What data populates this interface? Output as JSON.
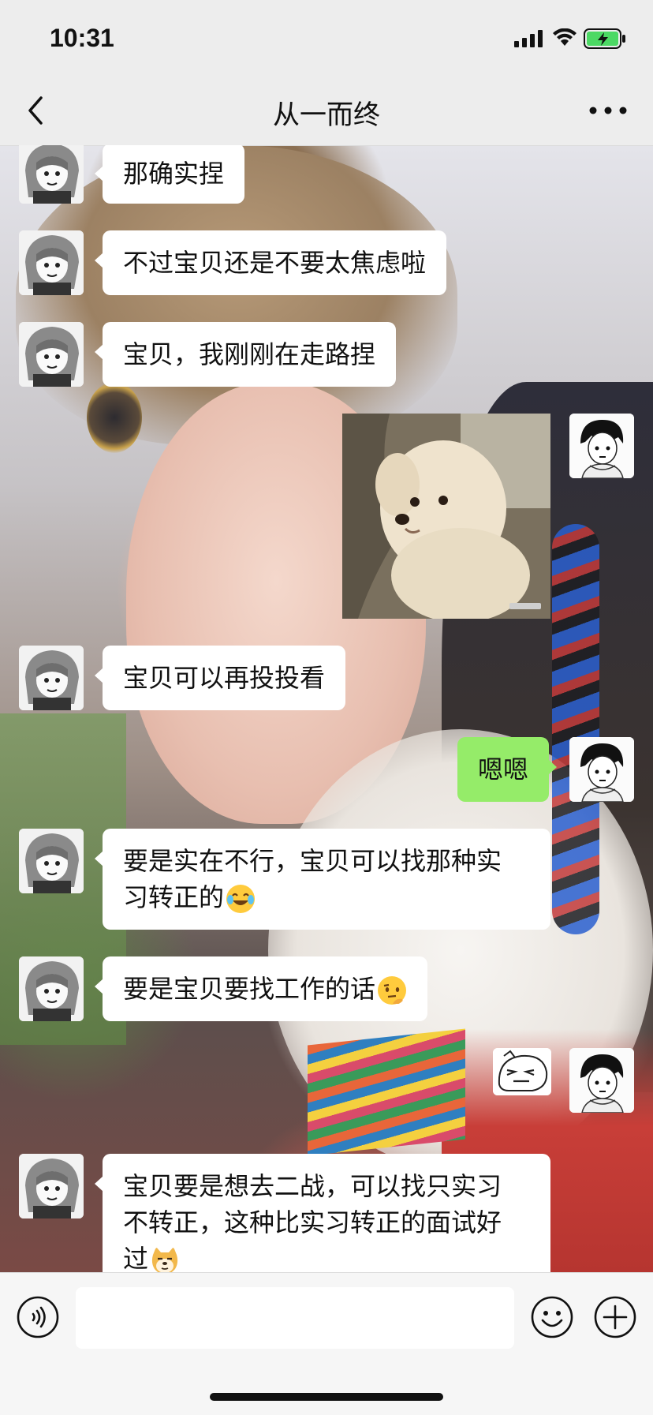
{
  "status_bar": {
    "time": "10:31"
  },
  "nav": {
    "title": "从一而终"
  },
  "messages": [
    {
      "side": "left",
      "text": "那确实捏"
    },
    {
      "side": "left",
      "text": "不过宝贝还是不要太焦虑啦"
    },
    {
      "side": "left",
      "text": "宝贝，我刚刚在走路捏"
    },
    {
      "side": "right",
      "type": "image",
      "icon": "puppy-photo"
    },
    {
      "side": "left",
      "text": "宝贝可以再投投看"
    },
    {
      "side": "right",
      "text": "嗯嗯"
    },
    {
      "side": "left",
      "text_line1": "要是实在不行，宝贝可以找那种实",
      "text_line2": "习转正的",
      "emoji": "laughing-tears-emoji"
    },
    {
      "side": "left",
      "text": "要是宝贝要找工作的话",
      "emoji": "thinking-emoji"
    },
    {
      "side": "right",
      "type": "sticker",
      "icon": "sticker-face"
    },
    {
      "side": "left",
      "text_line1": "宝贝要是想去二战，可以找只实习",
      "text_line2": "不转正，这种比实习转正的面试好",
      "text_line3": "过",
      "emoji": "doge-emoji"
    }
  ],
  "colors": {
    "my_bubble": "#95ec69",
    "their_bubble": "#ffffff",
    "bar_bg": "#ededed"
  }
}
